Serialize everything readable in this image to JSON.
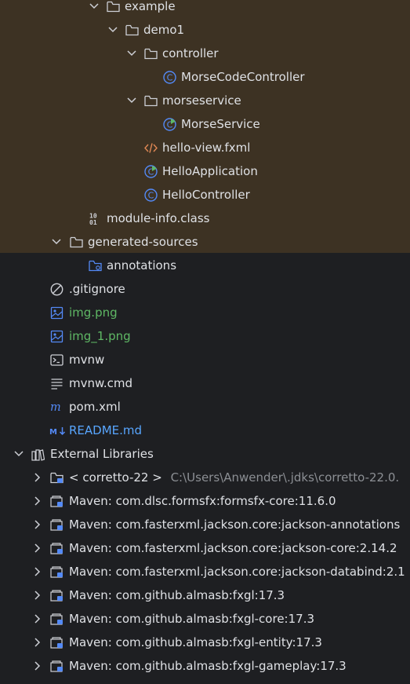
{
  "tree": {
    "example": "example",
    "demo1": "demo1",
    "controller": "controller",
    "morse_code_controller": "MorseCodeController",
    "morseservice": "morseservice",
    "morse_service": "MorseService",
    "hello_view": "hello-view.fxml",
    "hello_application": "HelloApplication",
    "hello_controller": "HelloController",
    "module_info": "module-info.class",
    "generated_sources": "generated-sources",
    "annotations": "annotations",
    "gitignore": ".gitignore",
    "img": "img.png",
    "img_1": "img_1.png",
    "mvnw": "mvnw",
    "mvnw_cmd": "mvnw.cmd",
    "pom": "pom.xml",
    "readme": "README.md",
    "external_libraries": "External Libraries",
    "jdk": {
      "name": "< corretto-22 >",
      "path": "C:\\Users\\Anwender\\.jdks\\corretto-22.0."
    },
    "libraries": [
      "Maven: com.dlsc.formsfx:formsfx-core:11.6.0",
      "Maven: com.fasterxml.jackson.core:jackson-annotations",
      "Maven: com.fasterxml.jackson.core:jackson-core:2.14.2",
      "Maven: com.fasterxml.jackson.core:jackson-databind:2.1",
      "Maven: com.github.almasb:fxgl:17.3",
      "Maven: com.github.almasb:fxgl-core:17.3",
      "Maven: com.github.almasb:fxgl-entity:17.3",
      "Maven: com.github.almasb:fxgl-gameplay:17.3"
    ]
  },
  "colors": {
    "background": "#1e1f22",
    "excluded_background": "#3d3223",
    "text": "#dfe1e5",
    "untracked_green": "#5fb865",
    "modified_blue": "#58a6ff",
    "path_gray": "#8c8f94"
  }
}
